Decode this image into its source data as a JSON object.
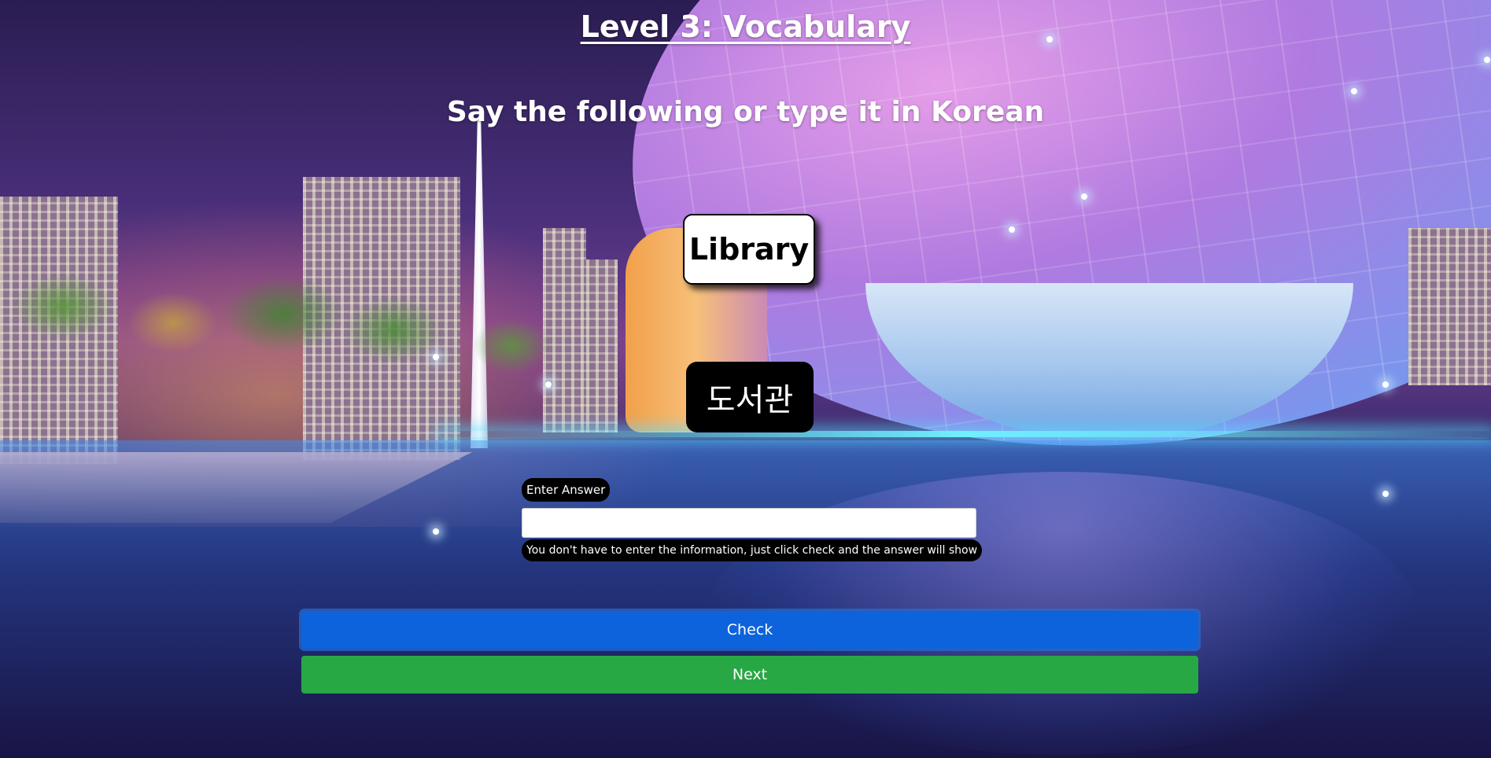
{
  "page": {
    "title": "Level 3: Vocabulary",
    "instruction": "Say the following or type it in Korean"
  },
  "vocab": {
    "english_word": "Library",
    "korean_word": "도서관"
  },
  "answer": {
    "label": "Enter Answer",
    "value": "",
    "hint": "You don't have to enter the information, just click check and the answer will show"
  },
  "buttons": {
    "check_label": "Check",
    "next_label": "Next"
  },
  "colors": {
    "check_button": "#0d63db",
    "next_button": "#28a745",
    "word_card_bg": "#ffffff",
    "korean_card_bg": "#000000"
  },
  "background": {
    "description_icon": "night-city-skyline-background"
  }
}
